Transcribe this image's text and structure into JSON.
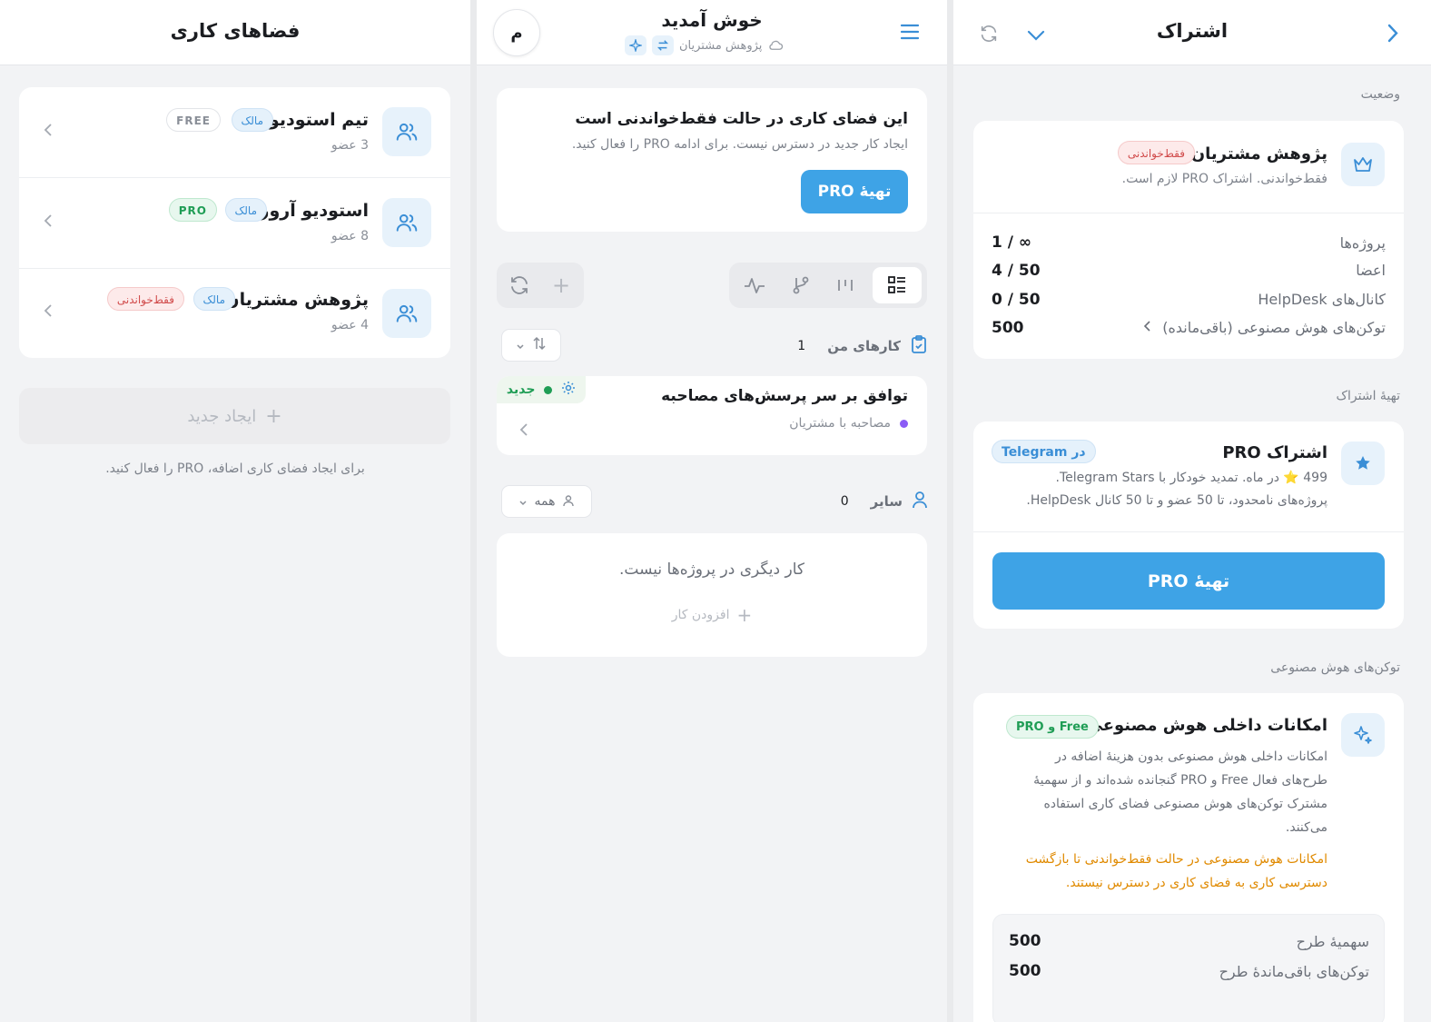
{
  "colors": {
    "accent": "#3ea3e6",
    "danger": "#d14b4b",
    "success": "#1f9d55",
    "warning": "#e08a00",
    "purple": "#8b5cf6"
  },
  "left": {
    "title": "فضاهای کاری",
    "workspaces": [
      {
        "name": "تیم استودیو",
        "members": "3 عضو",
        "role": "مالک",
        "plan": "FREE"
      },
      {
        "name": "استودیو آرورا",
        "members": "8 عضو",
        "role": "مالک",
        "plan": "PRO"
      },
      {
        "name": "پژوهش مشتریان",
        "members": "4 عضو",
        "role": "مالک",
        "plan": "فقط‌خواندنی"
      }
    ],
    "create_label": "ایجاد جدید",
    "create_hint": "برای ایجاد فضای کاری اضافه، PRO را فعال کنید."
  },
  "mid": {
    "avatar": "م",
    "title": "خوش آمدید",
    "subtitle": "پژوهش مشتریان",
    "readonly_title": "این فضای کاری در حالت فقط‌خواندنی است",
    "readonly_desc": "ایجاد کار جدید در دسترس نیست. برای ادامه PRO را فعال کنید.",
    "readonly_button": "تهیهٔ PRO",
    "my_tasks_label": "کارهای من",
    "my_tasks_count": "1",
    "task": {
      "title": "توافق بر سر پرسش‌های مصاحبه",
      "project": "مصاحبه با مشتریان",
      "status": "جدید"
    },
    "others_label": "سایر",
    "others_count": "0",
    "filter_all": "همه",
    "empty_text": "کار دیگری در پروژه‌ها نیست.",
    "add_task": "افزودن کار"
  },
  "right": {
    "title": "اشتراک",
    "status_section": "وضعیت",
    "ws_name": "پژوهش مشتریان",
    "ws_badge": "فقط‌خواندنی",
    "ws_desc": "فقط‌خواندنی. اشتراک PRO لازم است.",
    "usage": [
      {
        "label": "پروژه‌ها",
        "value": "1 / ∞"
      },
      {
        "label": "اعضا",
        "value": "4 / 50"
      },
      {
        "label": "کانال‌های HelpDesk",
        "value": "0 / 50"
      },
      {
        "label": "توکن‌های هوش مصنوعی (باقی‌مانده)",
        "value": "500"
      }
    ],
    "get_section": "تهیهٔ اشتراک",
    "pro_title": "اشتراک PRO",
    "pro_channel": "در Telegram",
    "pro_price": "499 ⭐️ در ماه. تمدید خودکار با Telegram Stars.",
    "pro_features": "پروژه‌های نامحدود، تا 50 عضو و تا 50 کانال HelpDesk.",
    "pro_button": "تهیهٔ PRO",
    "ai_section": "توکن‌های هوش مصنوعی",
    "ai_title": "امکانات داخلی هوش مصنوعی",
    "ai_badge": "Free و PRO",
    "ai_desc": "امکانات داخلی هوش مصنوعی بدون هزینهٔ اضافه در طرح‌های فعال Free و PRO گنجانده شده‌اند و از سهمیهٔ مشترک توکن‌های هوش مصنوعی فضای کاری استفاده می‌کنند.",
    "ai_warning": "امکانات هوش مصنوعی در حالت فقط‌خواندنی تا بازگشت دسترسی کاری به فضای کاری در دسترس نیستند.",
    "quota": [
      {
        "label": "سهمیهٔ طرح",
        "value": "500"
      },
      {
        "label": "توکن‌های باقی‌ماندهٔ طرح",
        "value": "500"
      }
    ]
  }
}
